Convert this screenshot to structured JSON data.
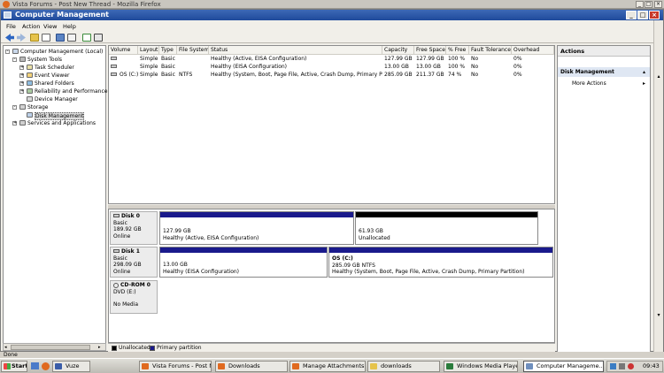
{
  "browser": {
    "title": "Vista Forums - Post New Thread - Mozilla Firefox",
    "status": "Done"
  },
  "window": {
    "title": "Computer Management"
  },
  "menubar": [
    "File",
    "Action",
    "View",
    "Help"
  ],
  "tree": [
    {
      "label": "Computer Management (Local)",
      "level": 0,
      "exp": "-"
    },
    {
      "label": "System Tools",
      "level": 1,
      "exp": "-"
    },
    {
      "label": "Task Scheduler",
      "level": 2,
      "exp": "+"
    },
    {
      "label": "Event Viewer",
      "level": 2,
      "exp": "+"
    },
    {
      "label": "Shared Folders",
      "level": 2,
      "exp": "+"
    },
    {
      "label": "Reliability and Performance",
      "level": 2,
      "exp": "+"
    },
    {
      "label": "Device Manager",
      "level": 2,
      "exp": ""
    },
    {
      "label": "Storage",
      "level": 1,
      "exp": "-"
    },
    {
      "label": "Disk Management",
      "level": 2,
      "exp": "",
      "selected": true
    },
    {
      "label": "Services and Applications",
      "level": 1,
      "exp": "+"
    }
  ],
  "volume_columns": [
    "Volume",
    "Layout",
    "Type",
    "File System",
    "Status",
    "Capacity",
    "Free Space",
    "% Free",
    "Fault Tolerance",
    "Overhead"
  ],
  "volumes": [
    [
      "",
      "Simple",
      "Basic",
      "",
      "Healthy (Active, EISA Configuration)",
      "127.99 GB",
      "127.99 GB",
      "100 %",
      "No",
      "0%"
    ],
    [
      "",
      "Simple",
      "Basic",
      "",
      "Healthy (EISA Configuration)",
      "13.00 GB",
      "13.00 GB",
      "100 %",
      "No",
      "0%"
    ],
    [
      "OS (C:)",
      "Simple",
      "Basic",
      "NTFS",
      "Healthy (System, Boot, Page File, Active, Crash Dump, Primary Partition)",
      "285.09 GB",
      "211.37 GB",
      "74 %",
      "No",
      "0%"
    ]
  ],
  "disks": {
    "disk0": {
      "name": "Disk 0",
      "type": "Basic",
      "size": "189.92 GB",
      "state": "Online",
      "p1": {
        "line1": "",
        "line2": "127.99 GB",
        "line3": "Healthy (Active, EISA Configuration)"
      },
      "p2": {
        "line1": "",
        "line2": "61.93 GB",
        "line3": "Unallocated"
      }
    },
    "disk1": {
      "name": "Disk 1",
      "type": "Basic",
      "size": "298.09 GB",
      "state": "Online",
      "p1": {
        "line1": "",
        "line2": "13.00 GB",
        "line3": "Healthy (EISA Configuration)"
      },
      "p2": {
        "line1": "OS  (C:)",
        "line2": "285.09 GB NTFS",
        "line3": "Healthy (System, Boot, Page File, Active, Crash Dump, Primary Partition)"
      }
    },
    "cdrom": {
      "name": "CD-ROM 0",
      "type": "DVD (E:)",
      "media": "No Media"
    }
  },
  "legend": {
    "unallocated": "Unallocated",
    "primary": "Primary partition"
  },
  "actions": {
    "header": "Actions",
    "section": "Disk Management",
    "more": "More Actions"
  },
  "taskbar": {
    "start": "Start",
    "items": [
      "Vuze",
      "Vista Forums - Post New...",
      "Downloads",
      "Manage Attachments - V...",
      "downloads",
      "Windows Media Player",
      "Computer Manageme..."
    ],
    "clock": "09:43"
  },
  "colors": {
    "primary_partition": "#1a1a8c",
    "unallocated": "#000000",
    "titlebar": "#2a56a8"
  }
}
